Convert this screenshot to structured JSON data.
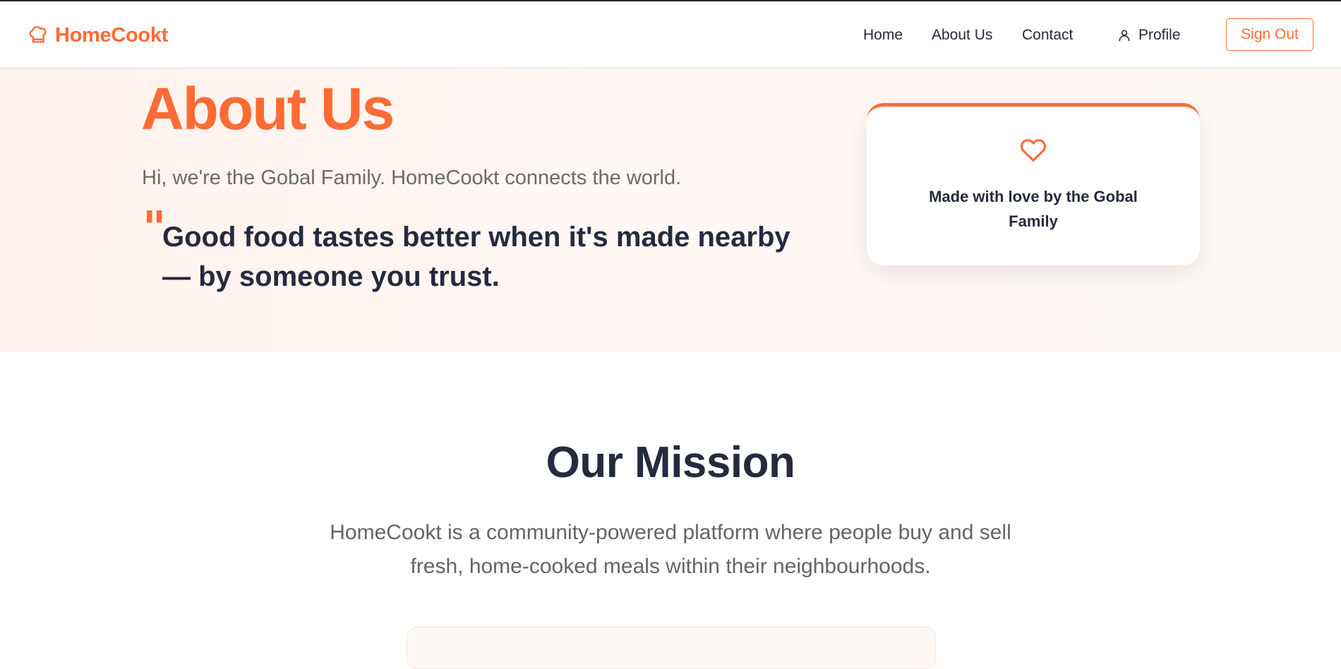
{
  "brand": {
    "name": "HomeCookt",
    "icon": "chef-hat-icon",
    "accent_color": "#ff6b35"
  },
  "nav": {
    "home": "Home",
    "about": "About Us",
    "contact": "Contact",
    "profile": "Profile",
    "profile_icon": "user-icon",
    "sign_out": "Sign Out"
  },
  "hero": {
    "title": "About Us",
    "intro": "Hi, we're the Gobal Family. HomeCookt connects the world.",
    "quote_mark": "\"",
    "quote": "Good food tastes better when it's made nearby — by someone you trust.",
    "card": {
      "icon": "heart-icon",
      "text": "Made with love by the Gobal Family"
    }
  },
  "mission": {
    "title": "Our Mission",
    "body": "HomeCookt is a community-powered platform where people buy and sell fresh, home-cooked meals within their neighbourhoods."
  },
  "colors": {
    "text_dark": "#262a3e",
    "text_muted": "#6b6b6b",
    "hero_background": "#fff4ef"
  }
}
